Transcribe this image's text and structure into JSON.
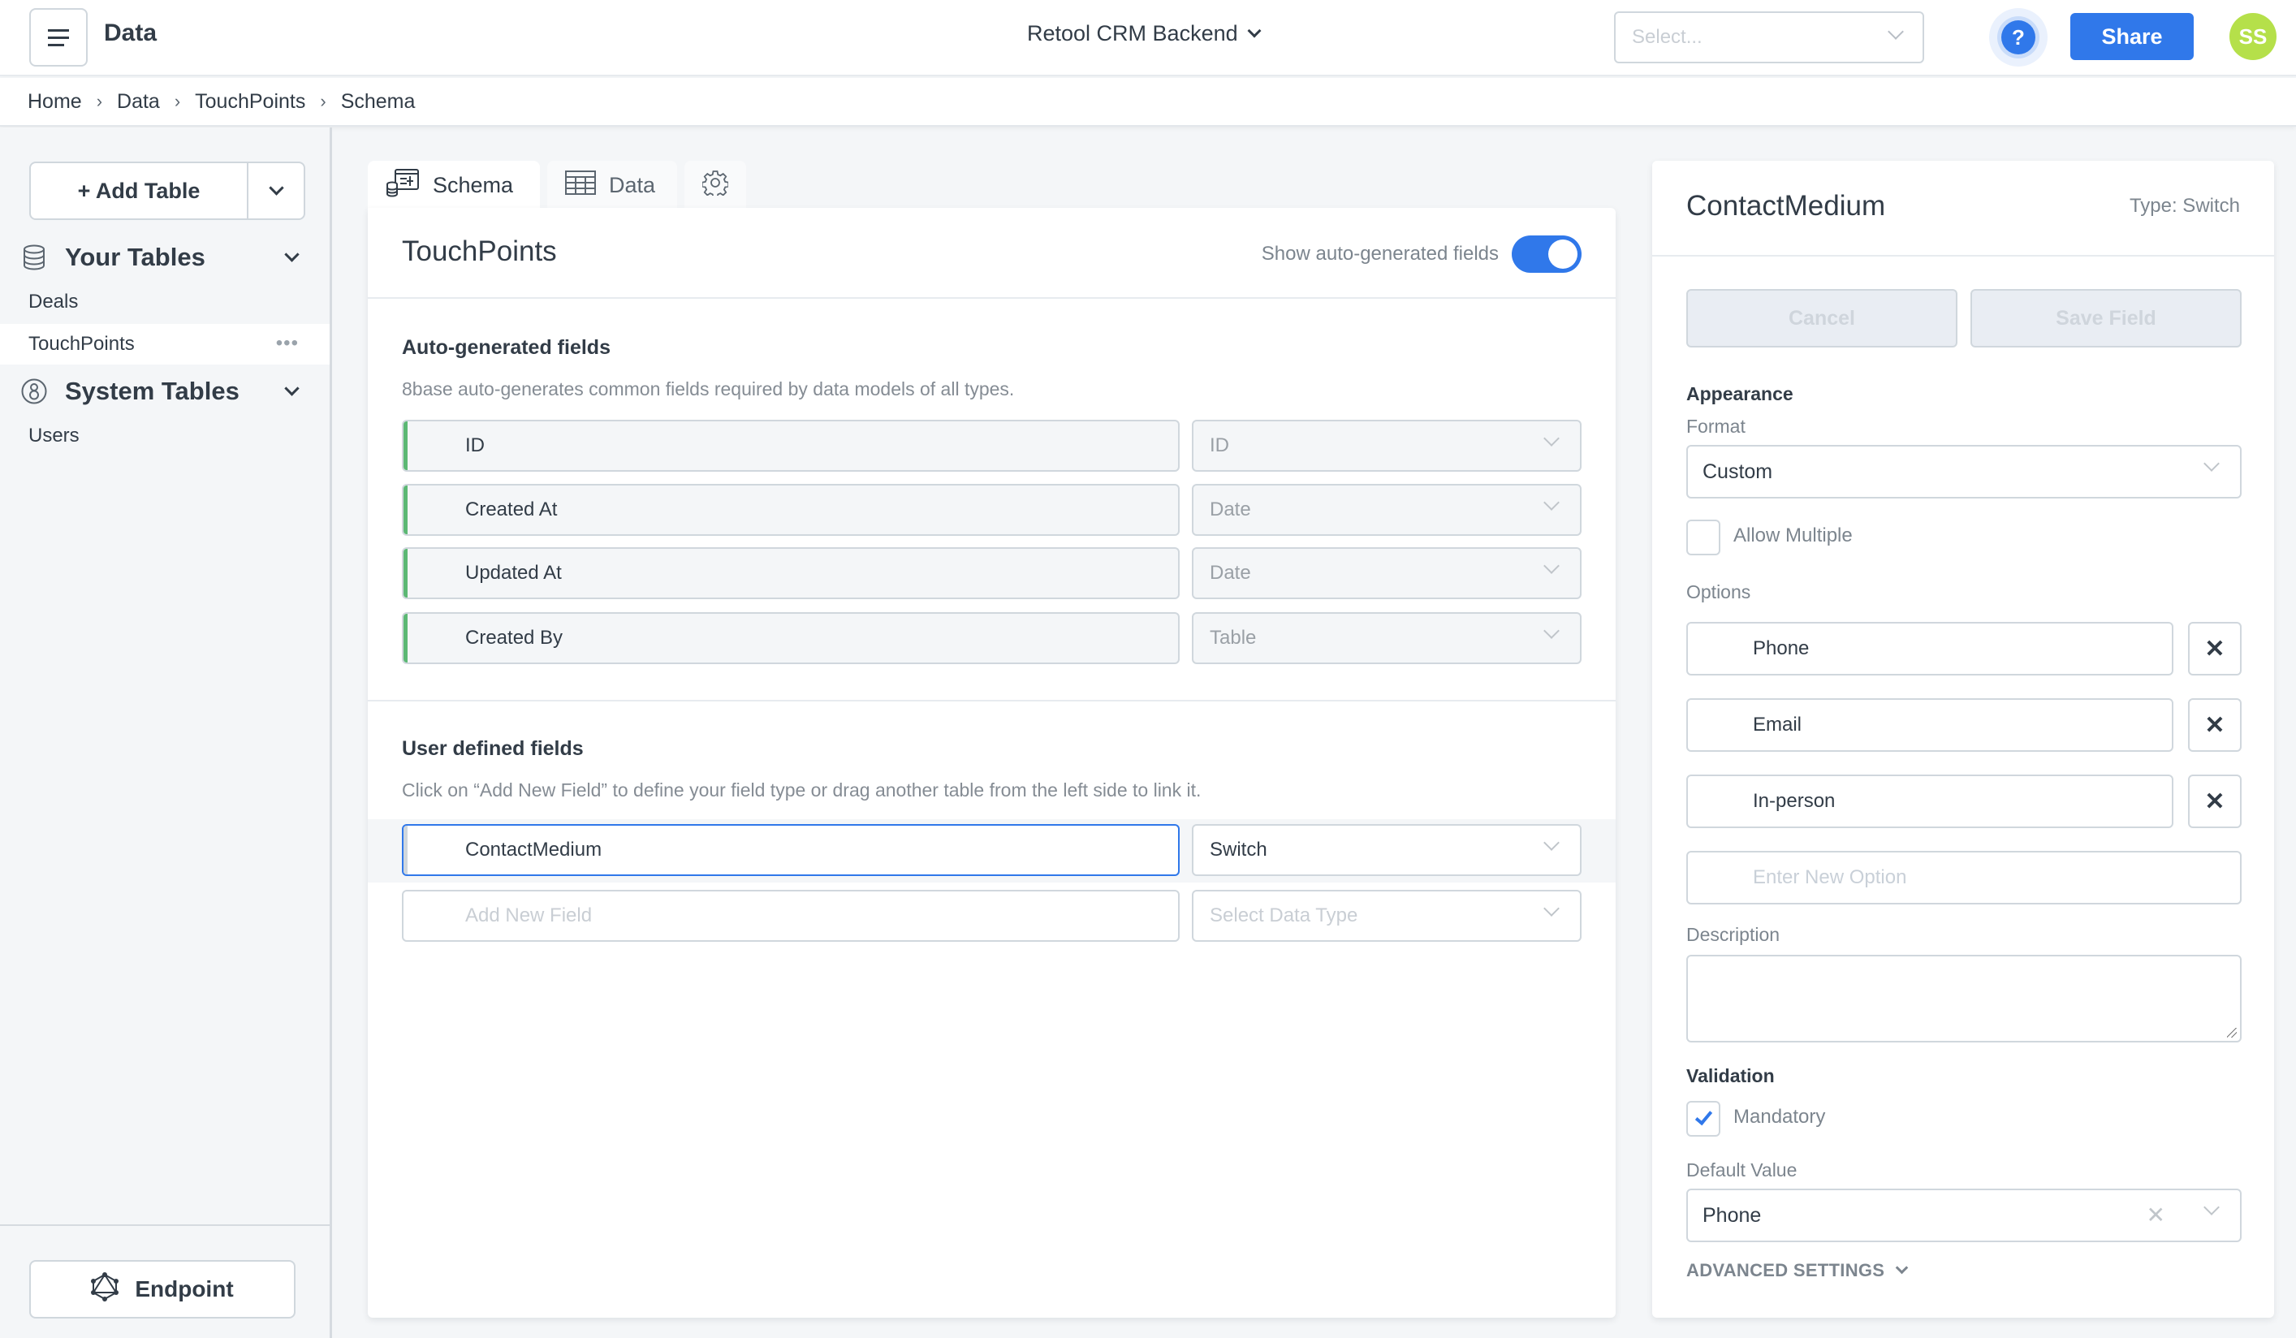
{
  "header": {
    "app_title": "Data",
    "workspace": "Retool CRM Backend",
    "select_placeholder": "Select...",
    "help_label": "?",
    "share_label": "Share",
    "avatar_initials": "SS"
  },
  "breadcrumb": [
    "Home",
    "Data",
    "TouchPoints",
    "Schema"
  ],
  "sidebar": {
    "add_table_label": "+ Add Table",
    "sections": [
      {
        "label": "Your Tables",
        "icon": "database-icon",
        "items": [
          "Deals",
          "TouchPoints"
        ]
      },
      {
        "label": "System Tables",
        "icon": "system-8base-icon",
        "items": [
          "Users"
        ]
      }
    ],
    "active_item": "TouchPoints",
    "more_label": "•••",
    "endpoint_label": "Endpoint"
  },
  "tabs": [
    {
      "label": "Schema",
      "icon": "schema-icon",
      "active": true
    },
    {
      "label": "Data",
      "icon": "table-grid-icon",
      "active": false
    },
    {
      "label": "",
      "icon": "gear-icon",
      "active": false
    }
  ],
  "schema": {
    "table_name": "TouchPoints",
    "toggle_label": "Show auto-generated fields",
    "toggle_on": true,
    "auto_section": {
      "title": "Auto-generated fields",
      "description": "8base auto-generates common fields required by data models of all types.",
      "fields": [
        {
          "name": "ID",
          "type": "ID"
        },
        {
          "name": "Created At",
          "type": "Date"
        },
        {
          "name": "Updated At",
          "type": "Date"
        },
        {
          "name": "Created By",
          "type": "Table"
        }
      ]
    },
    "user_section": {
      "title": "User defined fields",
      "description": "Click on “Add New Field” to define your field type or drag another table from the left side to link it.",
      "fields": [
        {
          "name": "ContactMedium",
          "type": "Switch"
        }
      ],
      "new_field_placeholder": "Add New Field",
      "new_type_placeholder": "Select Data Type"
    }
  },
  "field_panel": {
    "title": "ContactMedium",
    "type_label": "Type: Switch",
    "cancel_label": "Cancel",
    "save_label": "Save Field",
    "appearance_heading": "Appearance",
    "format_label": "Format",
    "format_value": "Custom",
    "allow_multiple_label": "Allow Multiple",
    "allow_multiple_checked": false,
    "options_label": "Options",
    "options": [
      "Phone",
      "Email",
      "In-person"
    ],
    "remove_label": "✕",
    "new_option_placeholder": "Enter New Option",
    "description_label": "Description",
    "description_value": "",
    "validation_heading": "Validation",
    "mandatory_label": "Mandatory",
    "mandatory_checked": true,
    "default_value_label": "Default Value",
    "default_value": "Phone",
    "clear_label": "✕",
    "advanced_label": "ADVANCED SETTINGS"
  },
  "colors": {
    "accent": "#3078ea",
    "auto_field_marker": "#5cb874",
    "avatar": "#b5e04a"
  }
}
